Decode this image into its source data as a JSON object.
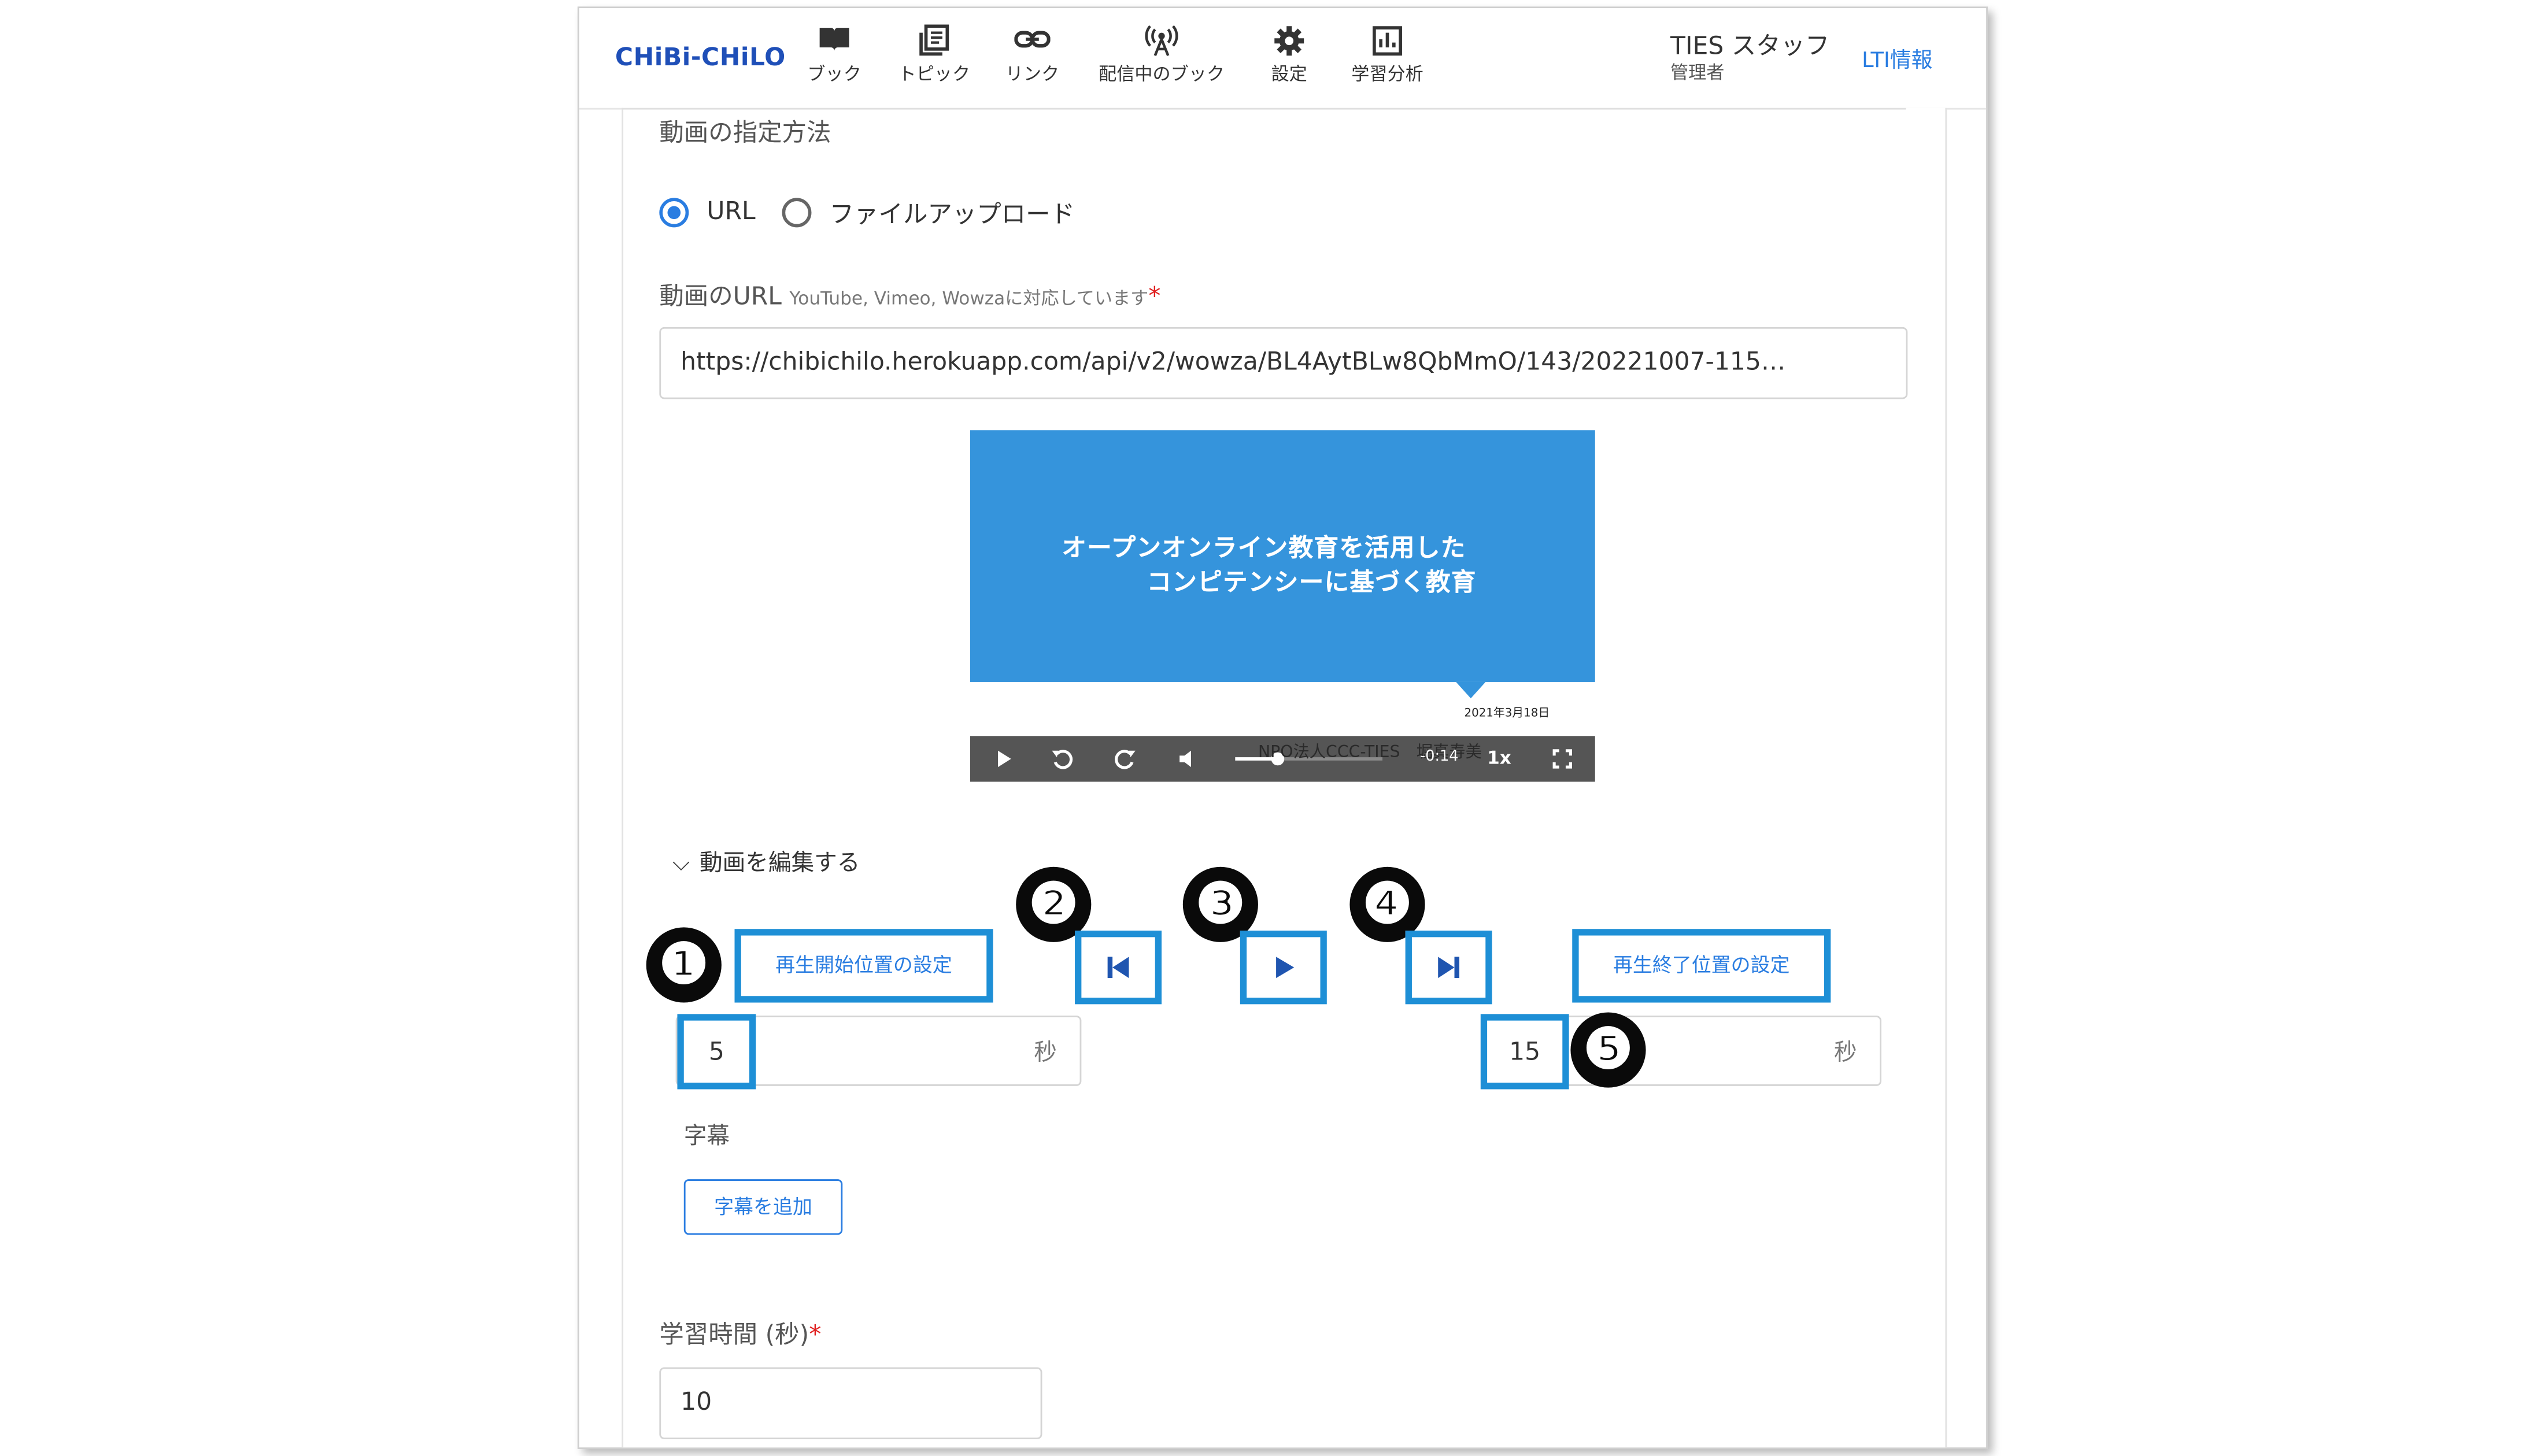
{
  "header": {
    "logo": "CHiBi-CHiLO",
    "nav": [
      {
        "label": "ブック",
        "icon": "book-icon"
      },
      {
        "label": "トピック",
        "icon": "topic-icon"
      },
      {
        "label": "リンク",
        "icon": "link-icon"
      },
      {
        "label": "配信中のブック",
        "icon": "broadcast-icon"
      },
      {
        "label": "設定",
        "icon": "gear-icon"
      },
      {
        "label": "学習分析",
        "icon": "analytics-icon"
      }
    ],
    "user_name": "TIES スタッフ",
    "user_role": "管理者",
    "lti_link": "LTI情報"
  },
  "form": {
    "method_label": "動画の指定方法",
    "method_options": [
      "URL",
      "ファイルアップロード"
    ],
    "method_selected": "URL",
    "url_label": "動画のURL",
    "url_hint": "YouTube, Vimeo, Wowzaに対応しています",
    "required_mark": "*",
    "url_value": "https://chibichilo.herokuapp.com/api/v2/wowza/BL4AytBLw8QbMmO/143/20221007-115…",
    "study_time_label": "学習時間 (秒)",
    "study_time_value": "10"
  },
  "video": {
    "slide_title_line1": "オープンオンライン教育を活用した",
    "slide_title_line2": "コンピテンシーに基づく教育",
    "slide_date": "2021年3月18日",
    "overlay_text": "NPO法人CCC-TIES　堀真寿美",
    "time_display": "-0:14",
    "playback_rate": "1x"
  },
  "editor": {
    "toggle_label": "動画を編集する",
    "set_start_button": "再生開始位置の設定",
    "set_end_button": "再生終了位置の設定",
    "start_value": "5",
    "end_value": "15",
    "seconds_unit": "秒",
    "subtitles_label": "字幕",
    "add_subtitle_button": "字幕を追加"
  },
  "callouts": [
    "❶",
    "❷",
    "❸",
    "❹",
    "❺"
  ],
  "colors": {
    "accent": "#2a7de1",
    "callout_border": "#1e8fd6",
    "slide_bg": "#3594dc",
    "logo": "#1f4fb8"
  }
}
